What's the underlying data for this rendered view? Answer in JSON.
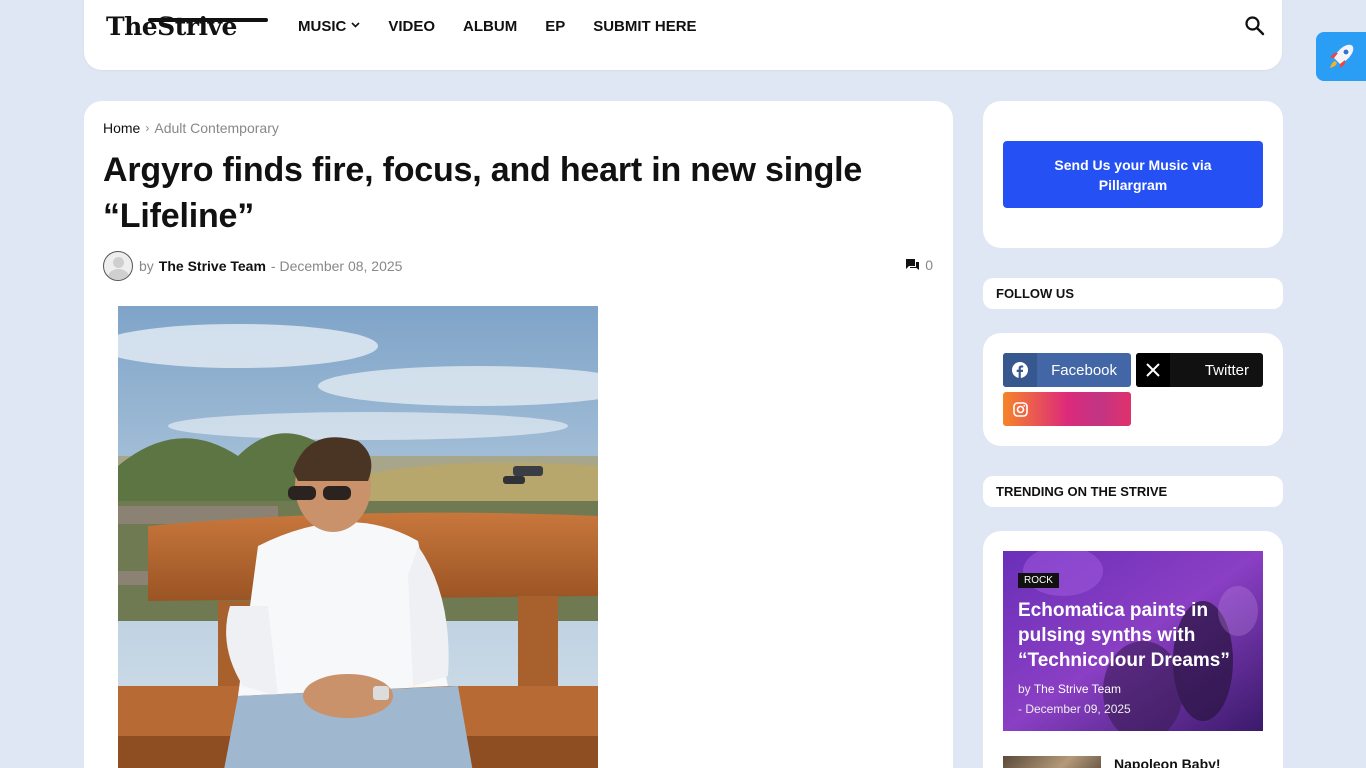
{
  "header": {
    "logo": "TheStrive",
    "nav": [
      {
        "label": "MUSIC",
        "has_dropdown": true
      },
      {
        "label": "VIDEO"
      },
      {
        "label": "ALBUM"
      },
      {
        "label": "EP"
      },
      {
        "label": "SUBMIT HERE"
      }
    ]
  },
  "article": {
    "breadcrumb": {
      "home": "Home",
      "separator": "›",
      "category": "Adult Contemporary"
    },
    "title": "Argyro finds fire, focus, and heart in new single “Lifeline”",
    "by": "by",
    "author": "The Strive Team",
    "date": "- December 08, 2025",
    "comment_count": "0"
  },
  "sidebar": {
    "send_button": "Send Us your Music via Pillargram",
    "follow_title": "FOLLOW US",
    "social": {
      "facebook": "Facebook",
      "twitter": "Twitter"
    },
    "trending_title": "TRENDING ON THE STRIVE",
    "trending": [
      {
        "tag": "ROCK",
        "title": "Echomatica paints in pulsing synths with “Technicolour Dreams”",
        "by": "by",
        "author": "The Strive Team",
        "date": "- December 09, 2025"
      },
      {
        "title": "Napoleon Baby!"
      }
    ]
  },
  "colors": {
    "background": "#dfe7f5",
    "accent_button": "#2551f4",
    "facebook": "#4367a6",
    "twitter": "#111111",
    "rocket": "#2a9df4"
  }
}
